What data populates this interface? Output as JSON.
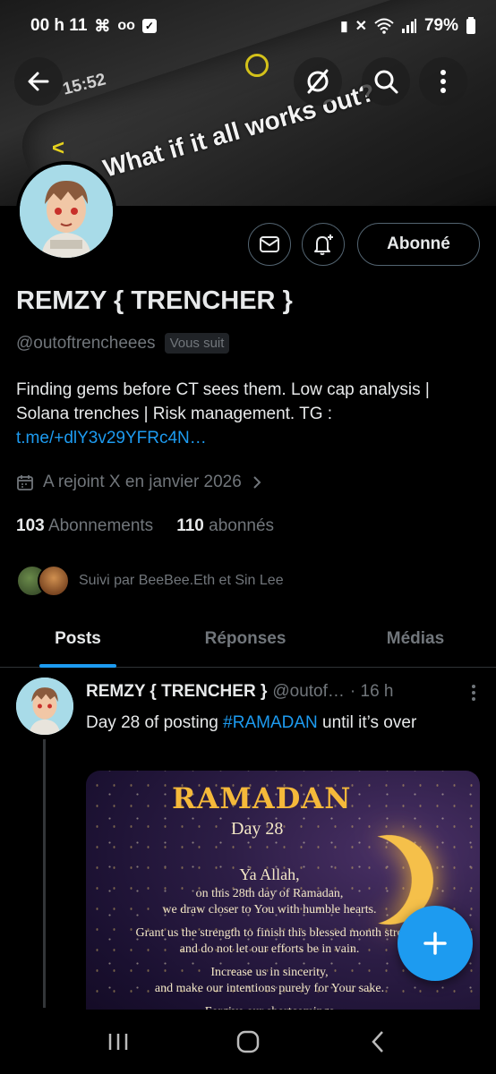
{
  "status_bar": {
    "time": "00 h 11",
    "battery": "79%"
  },
  "banner": {
    "phone_time": "15:52",
    "quote": "What if it all works out?"
  },
  "profile": {
    "name": "REMZY { TRENCHER }",
    "handle": "@outoftrencheees",
    "follows_you": "Vous suit",
    "bio_text": "Finding gems before CT sees them. Low cap analysis | Solana trenches | Risk management. TG : ",
    "bio_link": "t.me/+dlY3v29YFRc4N…",
    "joined": "A rejoint X en janvier 2026",
    "following_count": "103",
    "following_label": "Abonnements",
    "followers_count": "110",
    "followers_label": "abonnés",
    "followed_by": "Suivi par BeeBee.Eth et Sin Lee",
    "follow_button": "Abonné"
  },
  "tabs": [
    {
      "label": "Posts",
      "active": true
    },
    {
      "label": "Réponses",
      "active": false
    },
    {
      "label": "Médias",
      "active": false
    }
  ],
  "post": {
    "name": "REMZY { TRENCHER }",
    "handle": "@outof…",
    "time": "· 16 h",
    "text_before": "Day 28 of posting ",
    "hashtag": "#RAMADAN",
    "text_after": " until it’s over",
    "image": {
      "title": "RAMADAN",
      "day": "Day 28",
      "line1": "Ya Allah,",
      "lines": [
        "on this 28th day of Ramadan,",
        "we draw closer to You with humble hearts.",
        "",
        "Grant us the strength to finish this blessed month stro",
        "and do not let our efforts be in vain.",
        "",
        "Increase us in sincerity,",
        "and make our intentions purely for Your sake.",
        "",
        "Forgive our shortcomings"
      ]
    }
  },
  "colors": {
    "accent": "#1d9bf0",
    "background": "#000000",
    "text_secondary": "#71767b"
  }
}
